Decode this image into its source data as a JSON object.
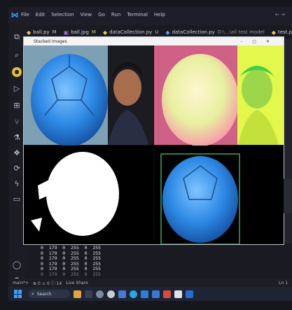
{
  "menubar": {
    "items": [
      "File",
      "Edit",
      "Selection",
      "View",
      "Go",
      "Run",
      "Terminal",
      "Help"
    ],
    "nav": "← →"
  },
  "tabs": [
    {
      "label": "ball.py",
      "status": "M",
      "color": "#e8c85a"
    },
    {
      "label": "ball.jpg",
      "status": "M",
      "color": "#9b6cd6"
    },
    {
      "label": "dataCollection.py",
      "status": "U",
      "color": "#e8c85a"
    },
    {
      "label": "dataCollection.py",
      "status": "D:\\...\\all test model",
      "color": "#4ba4ff"
    },
    {
      "label": "test.py",
      "status": "",
      "color": "#e8c85a"
    }
  ],
  "cv_window": {
    "title": "Stacked Images"
  },
  "terminal": {
    "lines": [
      "0  179  0  255  0  255",
      "0  179  0  255  0  255",
      "0  179  0  255  0  255",
      "0  179  0  255  0  255",
      "0  179  0  255  0  255",
      "0  179  0  255  0  255"
    ]
  },
  "statusbar": {
    "branch": "main*+",
    "problems": "⊗ 0 ⚠ 0 ⓘ 14",
    "live_share": "Live Share",
    "position": "Ln 1"
  },
  "taskbar": {
    "search": "Search"
  }
}
